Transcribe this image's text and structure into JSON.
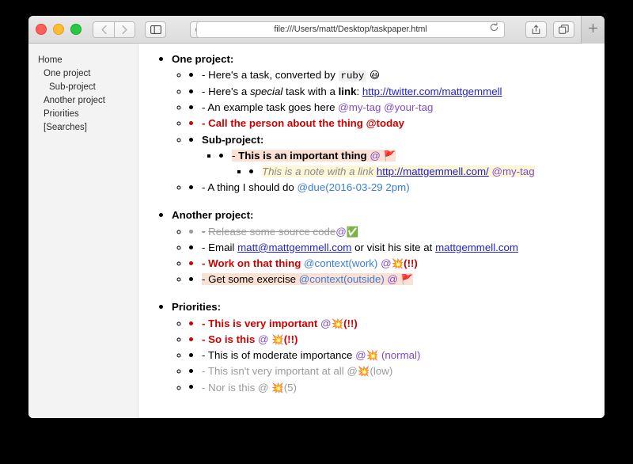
{
  "window": {
    "traffic_lights": [
      "close",
      "minimize",
      "maximize"
    ],
    "url": "file:///Users/matt/Desktop/taskpaper.html",
    "icons": {
      "back": "back-chevron-icon",
      "forward": "forward-chevron-icon",
      "sidebar": "sidebar-toggle-icon",
      "reader": "reader-icon",
      "security": "lock-icon",
      "reload": "reload-icon",
      "share": "share-icon",
      "tabs": "show-tabs-icon",
      "newtab": "+"
    }
  },
  "sidebar": {
    "items": [
      {
        "label": "Home",
        "indent": 0
      },
      {
        "label": "One project",
        "indent": 1
      },
      {
        "label": "Sub-project",
        "indent": 2
      },
      {
        "label": "Another project",
        "indent": 1
      },
      {
        "label": "Priorities",
        "indent": 1
      },
      {
        "label": "[Searches]",
        "indent": 1
      }
    ]
  },
  "page": {
    "projects": [
      {
        "title": "One project:",
        "tasks": {
          "t1_dash": "-",
          "t1_a": "Here's a task, converted by",
          "t1_code": "ruby",
          "t1_emoji": "😃",
          "t2_dash": "-",
          "t2_a": "Here's a",
          "t2_em": "special",
          "t2_b": "task with a",
          "t2_strong": "link",
          "t2_colon": ":",
          "t2_link": "http://twitter.com/mattgemmell",
          "t3_dash": "-",
          "t3_a": "An example task goes here",
          "t3_tag1": "@my-tag",
          "t3_tag2": "@your-tag",
          "t4_dash": "-",
          "t4_a": "Call the person about the thing @today"
        },
        "sub": {
          "title": "Sub-project:",
          "s1_dash": "-",
          "s1_a": "This is an important thing",
          "s1_at": "@",
          "s1_emoji": "🚩",
          "note_a": "This is a note with a link",
          "note_link": "http://mattgemmell.com/",
          "note_tag": "@my-tag"
        },
        "after": {
          "a1_dash": "-",
          "a1_a": "A thing I should do",
          "a1_tag": "@due(2016-03-29 2pm)"
        }
      },
      {
        "title": "Another project:",
        "rows": {
          "r1_dash": "-",
          "r1_a": "Release some source code",
          "r1_at": "@",
          "r1_emoji": "✅",
          "r2_dash": "-",
          "r2_a": "Email",
          "r2_link1": "matt@mattgemmell.com",
          "r2_b": "or visit his site at",
          "r2_link2": "mattgemmell.com",
          "r3_dash": "-",
          "r3_a": "Work on that thing",
          "r3_tag": "@context(work)",
          "r3_at": "@",
          "r3_emoji": "💥",
          "r3_prio": "(!!)",
          "r4_dash": "-",
          "r4_a": "Get some exercise",
          "r4_tag": "@context(outside)",
          "r4_at": "@",
          "r4_emoji": "🚩"
        }
      },
      {
        "title": "Priorities:",
        "rows": {
          "p1_dash": "-",
          "p1_a": "This is very important",
          "p1_at": "@",
          "p1_emoji": "💥",
          "p1_val": "(!!)",
          "p2_dash": "-",
          "p2_a": "So is this",
          "p2_at": "@",
          "p2_emoji": "💥",
          "p2_val": "(!!)",
          "p3_dash": "-",
          "p3_a": "This is of moderate importance",
          "p3_at": "@",
          "p3_emoji": "💥",
          "p3_val": "(normal)",
          "p4_dash": "-",
          "p4_a": "This isn't very important at all",
          "p4_at": "@",
          "p4_emoji": "💥",
          "p4_val": "(low)",
          "p5_dash": "-",
          "p5_a": "Nor is this",
          "p5_at": "@",
          "p5_emoji": "💥",
          "p5_val": "(5)"
        }
      }
    ]
  },
  "colors": {
    "tag_purple": "#7f4ccc",
    "tag_blue": "#3a7ddc",
    "priority_red": "#cf0000",
    "link_blue": "#2222cc",
    "highlight_peach": "#fbe0d4",
    "highlight_cream": "#fcf6d6",
    "muted_grey": "#9a9a9a"
  }
}
